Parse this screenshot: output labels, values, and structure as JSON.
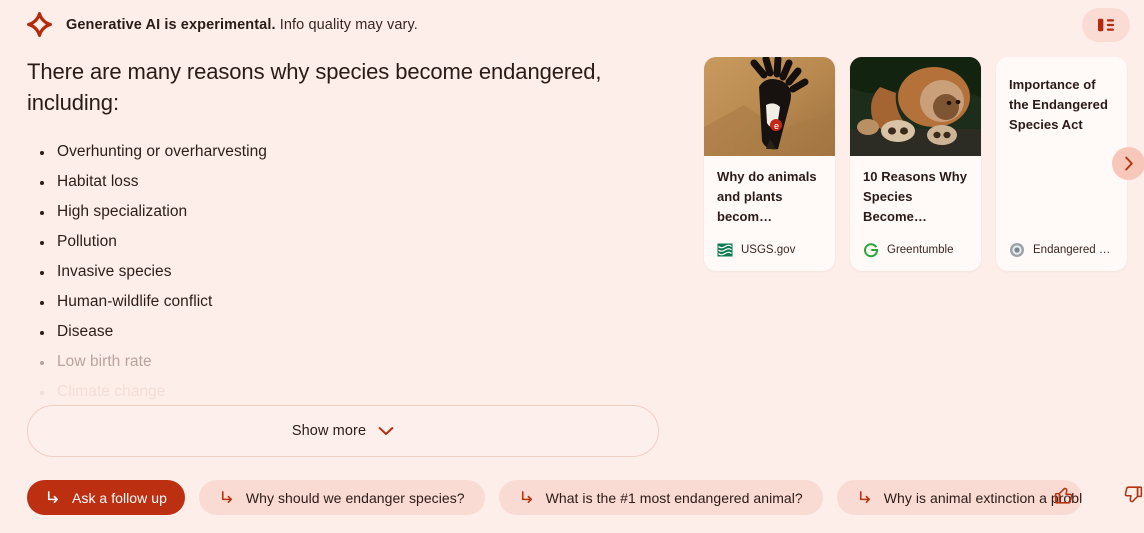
{
  "header": {
    "disclaimer_bold": "Generative AI is experimental.",
    "disclaimer_normal": "Info quality may vary.",
    "sparkle_icon": "sparkle-icon",
    "layout_button_icon": "layout-view-icon"
  },
  "answer": {
    "headline": "There are many reasons why species become endangered, including:",
    "bullets": [
      {
        "text": "Overhunting or overharvesting",
        "state": "visible"
      },
      {
        "text": "Habitat loss",
        "state": "visible"
      },
      {
        "text": "High specialization",
        "state": "visible"
      },
      {
        "text": "Pollution",
        "state": "visible"
      },
      {
        "text": "Invasive species",
        "state": "visible"
      },
      {
        "text": "Human-wildlife conflict",
        "state": "visible"
      },
      {
        "text": "Disease",
        "state": "visible"
      },
      {
        "text": "Low birth rate",
        "state": "faded"
      },
      {
        "text": "Climate change",
        "state": "faded-more"
      }
    ]
  },
  "show_more": {
    "label": "Show more",
    "icon": "chevron-down-icon"
  },
  "cards": {
    "next_button_icon": "chevron-right-icon",
    "items": [
      {
        "title": "Why do animals and plants becom…",
        "source": "USGS.gov",
        "source_icon": "usgs-favicon",
        "image": "flying-condor-photo",
        "has_image": true
      },
      {
        "title": "10 Reasons Why Species Become…",
        "source": "Greentumble",
        "source_icon": "greentumble-favicon",
        "image": "orangutan-photo",
        "has_image": true
      },
      {
        "title": "Importance of the Endangered Species Act",
        "source": "Endangered …",
        "source_icon": "endangered-seal-favicon",
        "image": "",
        "has_image": false
      }
    ]
  },
  "followups": {
    "arrow_icon": "arrow-turn-down-right-icon",
    "chips": [
      {
        "label": "Ask a follow up",
        "primary": true
      },
      {
        "label": "Why should we endanger species?",
        "primary": false
      },
      {
        "label": "What is the #1 most endangered animal?",
        "primary": false
      },
      {
        "label": "Why is animal extinction a proble",
        "primary": false
      }
    ]
  },
  "rating": {
    "thumb_up_icon": "thumb-up-icon",
    "thumb_down_icon": "thumb-down-icon"
  },
  "colors": {
    "page_bg": "#fdeeea",
    "accent": "#bc2f11",
    "chip_bg": "#fadbd3",
    "card_bg": "#fffaf8"
  }
}
